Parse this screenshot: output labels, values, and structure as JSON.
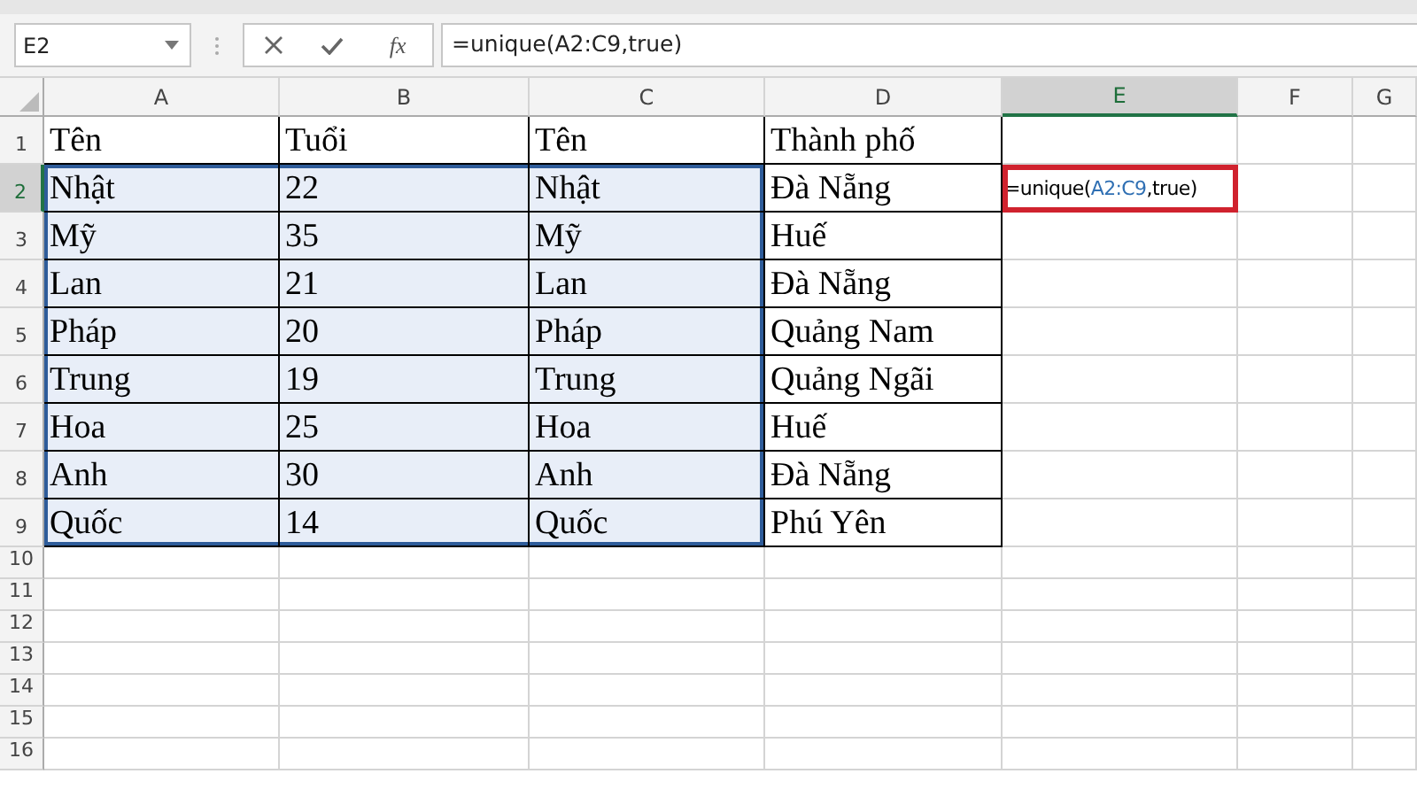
{
  "name_box": {
    "value": "E2"
  },
  "formula_bar": {
    "function_button": "fx",
    "formula": "=unique(A2:C9,true)"
  },
  "columns": [
    {
      "label": "A",
      "selected": false
    },
    {
      "label": "B",
      "selected": false
    },
    {
      "label": "C",
      "selected": false
    },
    {
      "label": "D",
      "selected": false
    },
    {
      "label": "E",
      "selected": true
    },
    {
      "label": "F",
      "selected": false
    },
    {
      "label": "G",
      "selected": false
    }
  ],
  "rows": [
    {
      "number": "1",
      "selected": false,
      "cells": [
        {
          "text": "Tên",
          "selected": false
        },
        {
          "text": "Tuổi",
          "selected": false
        },
        {
          "text": "Tên",
          "selected": false
        },
        {
          "text": "Thành phố",
          "selected": false
        },
        {
          "selected": false
        },
        {
          "selected": false
        },
        {
          "selected": false
        }
      ]
    },
    {
      "number": "2",
      "selected": true,
      "cells": [
        {
          "text": "Nhật",
          "selected": true
        },
        {
          "text": "22",
          "selected": true
        },
        {
          "text": "Nhật",
          "selected": true
        },
        {
          "text": "Đà Nẵng",
          "selected": false
        },
        {
          "parts": [
            {
              "kind": "plain",
              "text": "=unique("
            },
            {
              "kind": "reference",
              "text": "A2:C9"
            },
            {
              "kind": "plain",
              "text": ",true)"
            }
          ],
          "selected": false,
          "highlighted": true
        },
        {
          "selected": false
        },
        {
          "selected": false
        }
      ]
    },
    {
      "number": "3",
      "selected": false,
      "cells": [
        {
          "text": "Mỹ",
          "selected": true
        },
        {
          "text": "35",
          "selected": true
        },
        {
          "text": "Mỹ",
          "selected": true
        },
        {
          "text": "Huế",
          "selected": false
        },
        {
          "selected": false
        },
        {
          "selected": false
        },
        {
          "selected": false
        }
      ]
    },
    {
      "number": "4",
      "selected": false,
      "cells": [
        {
          "text": "Lan",
          "selected": true
        },
        {
          "text": "21",
          "selected": true
        },
        {
          "text": "Lan",
          "selected": true
        },
        {
          "text": "Đà Nẵng",
          "selected": false
        },
        {
          "selected": false
        },
        {
          "selected": false
        },
        {
          "selected": false
        }
      ]
    },
    {
      "number": "5",
      "selected": false,
      "cells": [
        {
          "text": "Pháp",
          "selected": true
        },
        {
          "text": "20",
          "selected": true
        },
        {
          "text": "Pháp",
          "selected": true
        },
        {
          "text": "Quảng Nam",
          "selected": false
        },
        {
          "selected": false
        },
        {
          "selected": false
        },
        {
          "selected": false
        }
      ]
    },
    {
      "number": "6",
      "selected": false,
      "cells": [
        {
          "text": "Trung",
          "selected": true
        },
        {
          "text": "19",
          "selected": true
        },
        {
          "text": "Trung",
          "selected": true
        },
        {
          "text": "Quảng Ngãi",
          "selected": false
        },
        {
          "selected": false
        },
        {
          "selected": false
        },
        {
          "selected": false
        }
      ]
    },
    {
      "number": "7",
      "selected": false,
      "cells": [
        {
          "text": "Hoa",
          "selected": true
        },
        {
          "text": "25",
          "selected": true
        },
        {
          "text": "Hoa",
          "selected": true
        },
        {
          "text": "Huế",
          "selected": false
        },
        {
          "selected": false
        },
        {
          "selected": false
        },
        {
          "selected": false
        }
      ]
    },
    {
      "number": "8",
      "selected": false,
      "cells": [
        {
          "text": "Anh",
          "selected": true
        },
        {
          "text": "30",
          "selected": true
        },
        {
          "text": "Anh",
          "selected": true
        },
        {
          "text": "Đà Nẵng",
          "selected": false
        },
        {
          "selected": false
        },
        {
          "selected": false
        },
        {
          "selected": false
        }
      ]
    },
    {
      "number": "9",
      "selected": false,
      "cells": [
        {
          "text": "Quốc",
          "selected": true
        },
        {
          "text": "14",
          "selected": true
        },
        {
          "text": "Quốc",
          "selected": true
        },
        {
          "text": "Phú Yên",
          "selected": false
        },
        {
          "selected": false
        },
        {
          "selected": false
        },
        {
          "selected": false
        }
      ]
    },
    {
      "number": "10",
      "selected": false
    },
    {
      "number": "11",
      "selected": false
    },
    {
      "number": "12",
      "selected": false
    },
    {
      "number": "13",
      "selected": false
    },
    {
      "number": "14",
      "selected": false
    },
    {
      "number": "15",
      "selected": false
    },
    {
      "number": "16",
      "selected": false
    }
  ]
}
